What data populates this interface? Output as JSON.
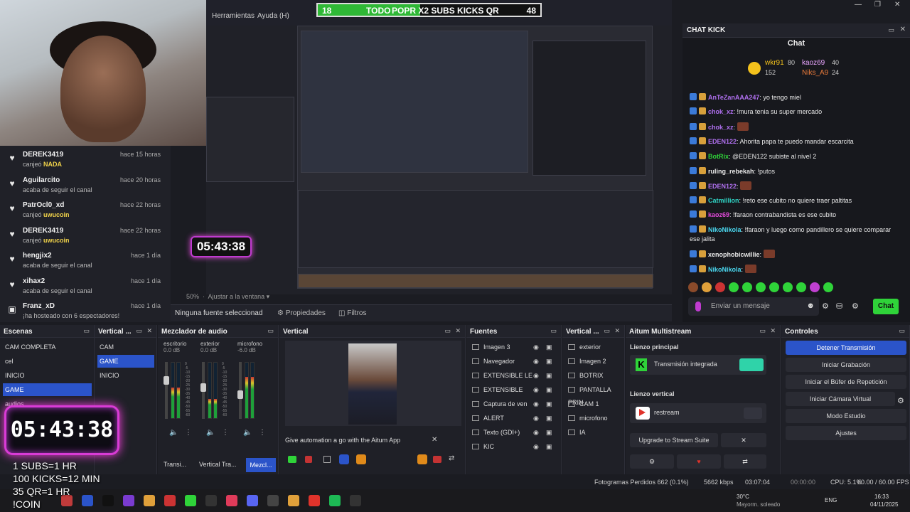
{
  "menubar": {
    "items": [
      "Herramientas",
      "Ayuda (H)"
    ]
  },
  "ticker": {
    "left": "18",
    "middle": "TODO",
    "label": "POPR X2 SUBS KICKS QR",
    "right": "48",
    "progress": 0.46
  },
  "preview": {
    "timer": "05:43:38",
    "zoom": "50%",
    "zoom_mode": "Ajustar a la ventana"
  },
  "feed": [
    {
      "name": "DEREK3419",
      "time": "hace 15 horas",
      "pre": "canjeó",
      "highlight": "NADA",
      "icon": "heart-icon"
    },
    {
      "name": "Aguilarcito",
      "time": "hace 20 horas",
      "pre": "acaba de seguir el canal",
      "highlight": "",
      "icon": "heart-icon"
    },
    {
      "name": "PatrOcl0_xd",
      "time": "hace 22 horas",
      "pre": "canjeó",
      "highlight": "uwucoin",
      "icon": "heart-icon"
    },
    {
      "name": "DEREK3419",
      "time": "hace 22 horas",
      "pre": "canjeó",
      "highlight": "uwucoin",
      "icon": "heart-icon"
    },
    {
      "name": "hengjix2",
      "time": "hace 1 día",
      "pre": "acaba de seguir el canal",
      "highlight": "",
      "icon": "heart-icon"
    },
    {
      "name": "xihax2",
      "time": "hace 1 día",
      "pre": "acaba de seguir el canal",
      "highlight": "",
      "icon": "heart-icon"
    },
    {
      "name": "Franz_xD",
      "time": "hace 1 día",
      "pre": "¡ha hosteado con 6 espectadores!",
      "highlight": "",
      "icon": "host-icon"
    }
  ],
  "sourcebar": {
    "status": "Ninguna fuente seleccionad",
    "properties": "Propiedades",
    "filters": "Filtros"
  },
  "chat": {
    "title": "CHAT KICK",
    "tab": "Chat",
    "board": [
      {
        "name": "wkr91",
        "count": "80"
      },
      {
        "name": "kaoz69",
        "count": "40"
      },
      {
        "name": "152",
        "count": ""
      },
      {
        "name": "Niks_A9",
        "count": "24"
      }
    ],
    "messages": [
      {
        "user": "AnTeZanAAA247",
        "text": ": yo tengo miel",
        "color": "#b070f0"
      },
      {
        "user": "chok_xz",
        "text": ": !mura tenia su super mercado",
        "color": "#b070f0"
      },
      {
        "user": "chok_xz",
        "text": ":",
        "color": "#b070f0"
      },
      {
        "user": "EDEN122",
        "text": ": Ahorita papa te puedo mandar escarcita",
        "color": "#b070f0"
      },
      {
        "user": "BotRix",
        "text": ": @EDEN122 subiste al nivel 2",
        "color": "#2fd339"
      },
      {
        "user": "ruling_rebekah",
        "text": ": !putos",
        "color": "#e8e8e8"
      },
      {
        "user": "EDEN122",
        "text": ":",
        "color": "#b070f0"
      },
      {
        "user": "Catmillion",
        "text": ": !reto ese cubito no quiere traer paltitas",
        "color": "#2fd3c4"
      },
      {
        "user": "kaoz69",
        "text": ": !faraon contrabandista es ese cubito",
        "color": "#e04ad8"
      },
      {
        "user": "NikoNikola",
        "text": ": !faraon y luego como pandillero se quiere comparar",
        "color": "#4ad8f0"
      },
      {
        "user": "",
        "text": "ese jalita",
        "color": "#e8e8e8"
      },
      {
        "user": "xenophobicwillie",
        "text": ":",
        "color": "#e8e8e8"
      },
      {
        "user": "NikoNikola",
        "text": ":",
        "color": "#4ad8f0"
      }
    ],
    "input_placeholder": "Enviar un mensaje",
    "send": "Chat"
  },
  "docks": {
    "scenes": {
      "title": "Escenas",
      "items": [
        "CAM COMPLETA",
        "cel",
        "INICIO",
        "GAME",
        "audios"
      ],
      "selected": 3
    },
    "vertical_scenes": {
      "title": "Vertical ...",
      "items": [
        "CAM",
        "GAME",
        "INICIO"
      ],
      "selected": 1
    },
    "mixer": {
      "title": "Mezclador de audio",
      "channels": [
        {
          "name": "escritorio",
          "db": "0.0 dB",
          "level": 0.55
        },
        {
          "name": "exterior",
          "db": "0.0 dB",
          "level": 0.35
        },
        {
          "name": "microfono",
          "db": "-6.0 dB",
          "level": 0.75
        }
      ],
      "ticks": [
        "0",
        "-5",
        "-10",
        "-15",
        "-20",
        "-25",
        "-30",
        "-35",
        "-40",
        "-45",
        "-50",
        "-55",
        "-60"
      ]
    },
    "vertical": {
      "title": "Vertical",
      "ad": "Give automation a go with the Aitum App"
    },
    "sources": {
      "title": "Fuentes",
      "items": [
        "Imagen 3",
        "Navegador",
        "EXTENSIBLE LE",
        "EXTENSIBLE",
        "Captura de ven",
        "ALERT",
        "Texto (GDI+)",
        "KIC"
      ]
    },
    "vertical_sources": {
      "title": "Vertical ...",
      "items": [
        "exterior",
        "Imagen 2",
        "BOTRIX",
        "PANTALLA PRIN",
        "CAM 1",
        "microfono",
        "IA"
      ]
    },
    "aitum": {
      "title": "Aitum Multistream",
      "main": "Lienzo principal",
      "main_item": "Transmisión integrada",
      "vertical": "Lienzo vertical",
      "vertical_item": "restream",
      "upgrade": "Upgrade to Stream Suite"
    },
    "controls": {
      "title": "Controles",
      "buttons": [
        "Detener Transmisión",
        "Iniciar Grabación",
        "Iniciar el Búfer de Repetición",
        "Iniciar Cámara Virtual",
        "Modo Estudio",
        "Ajustes"
      ]
    },
    "tabs": [
      "Transi...",
      "Vertical Tra...",
      "Mezcl..."
    ]
  },
  "status": {
    "dropped": "Fotogramas Perdidos 662 (0.1%)",
    "kbps": "5662 kbps",
    "live": "03:07:04",
    "rec": "00:00:00",
    "cpu": "CPU: 5.1%",
    "fps": "60.00 / 60.00 FPS"
  },
  "overlay": {
    "timer": "05:43:38",
    "lines": [
      "1 SUBS=1 HR",
      "100 KICKS=12 MIN",
      "35 QR=1 HR",
      "!COIN"
    ]
  },
  "taskbar": {
    "weather_temp": "30°C",
    "weather_desc": "Mayorm. soleado",
    "lang": "ENG",
    "time": "16:33",
    "date": "04/11/2025"
  }
}
